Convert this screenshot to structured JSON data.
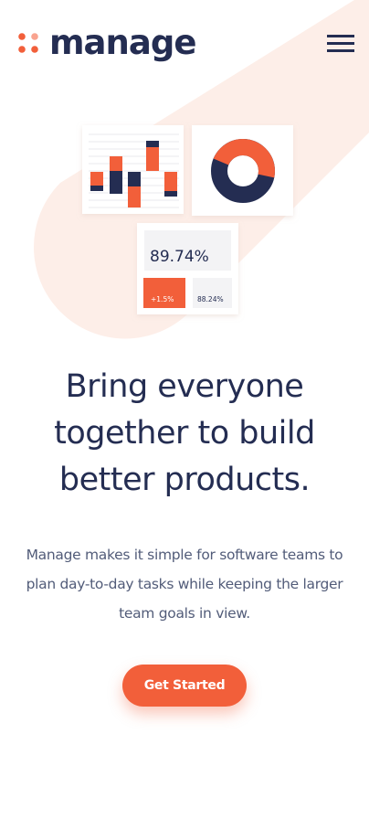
{
  "brand": {
    "name": "manage",
    "accent_color": "#F25F3A",
    "dark_color": "#242D52",
    "soft_tint": "#FDEEE8"
  },
  "nav": {
    "menu_icon": "hamburger-menu-icon"
  },
  "illustration": {
    "stat_value": "89.74%",
    "badge_primary": "+1.5%",
    "badge_secondary": "88.24%"
  },
  "hero": {
    "headline": "Bring everyone together to build better products.",
    "description": "Manage makes it simple for software teams to plan day-to-day tasks while keeping the larger team goals in view.",
    "cta_label": "Get Started"
  }
}
